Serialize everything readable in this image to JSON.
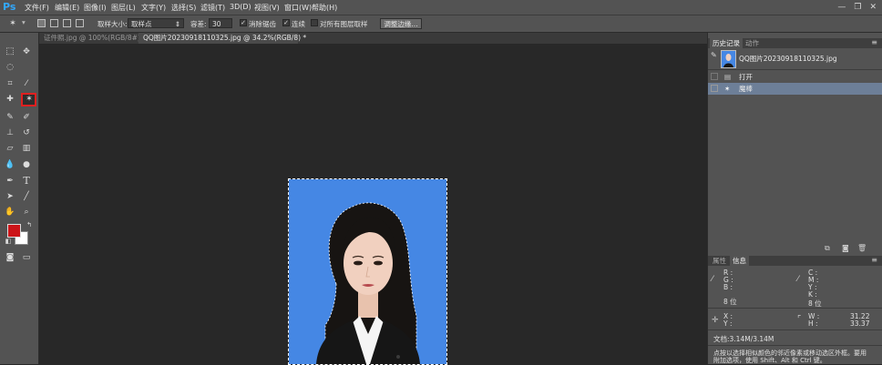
{
  "app": {
    "logo": "Ps"
  },
  "menu": [
    "文件(F)",
    "编辑(E)",
    "图像(I)",
    "图层(L)",
    "文字(Y)",
    "选择(S)",
    "滤镜(T)",
    "3D(D)",
    "视图(V)",
    "窗口(W)",
    "帮助(H)"
  ],
  "window_controls": {
    "minimize": "—",
    "restore": "❐",
    "close": "✕"
  },
  "options": {
    "sample_size_label": "取样大小:",
    "sample_size_value": "取样点",
    "tolerance_label": "容差:",
    "tolerance_value": "30",
    "anti_alias_label": "消除锯齿",
    "anti_alias_checked": true,
    "contiguous_label": "连续",
    "contiguous_checked": true,
    "sample_all_layers_label": "对所有图层取样",
    "sample_all_layers_checked": false,
    "refine_edge_label": "调整边缘..."
  },
  "tabs": [
    {
      "label": "证件照.jpg @ 100%(RGB/8#) *",
      "active": false
    },
    {
      "label": "QQ图片20230918110325.jpg @ 34.2%(RGB/8) *",
      "active": true
    }
  ],
  "colors": {
    "foreground": "#cc1418",
    "background": "#ffffff",
    "canvas_bg": "#4587e4",
    "selection_highlight": "#e02020"
  },
  "history_panel": {
    "tabs": [
      "历史记录",
      "动作"
    ],
    "snapshot": "QQ图片20230918110325.jpg",
    "steps": [
      {
        "label": "打开",
        "icon": "document-icon",
        "selected": false
      },
      {
        "label": "魔棒",
        "icon": "magic-wand-icon",
        "selected": true
      }
    ]
  },
  "info_panel": {
    "tabs": [
      "属性",
      "信息"
    ],
    "left_channels": [
      "R :",
      "G :",
      "B :"
    ],
    "left_depth": "8 位",
    "right_channels": [
      "C :",
      "M :",
      "Y :",
      "K :"
    ],
    "right_depth": "8 位",
    "xy": [
      "X :",
      "Y :"
    ],
    "wh": [
      {
        "label": "W :",
        "value": "31.22"
      },
      {
        "label": "H :",
        "value": "33.37"
      }
    ],
    "doc_size": "文档:3.14M/3.14M",
    "hint_line1": "点按以选择相似颜色的邻近像素或移动选区外框。要用",
    "hint_line2": "附加选项，使用 Shift、Alt 和 Ctrl 键。"
  }
}
